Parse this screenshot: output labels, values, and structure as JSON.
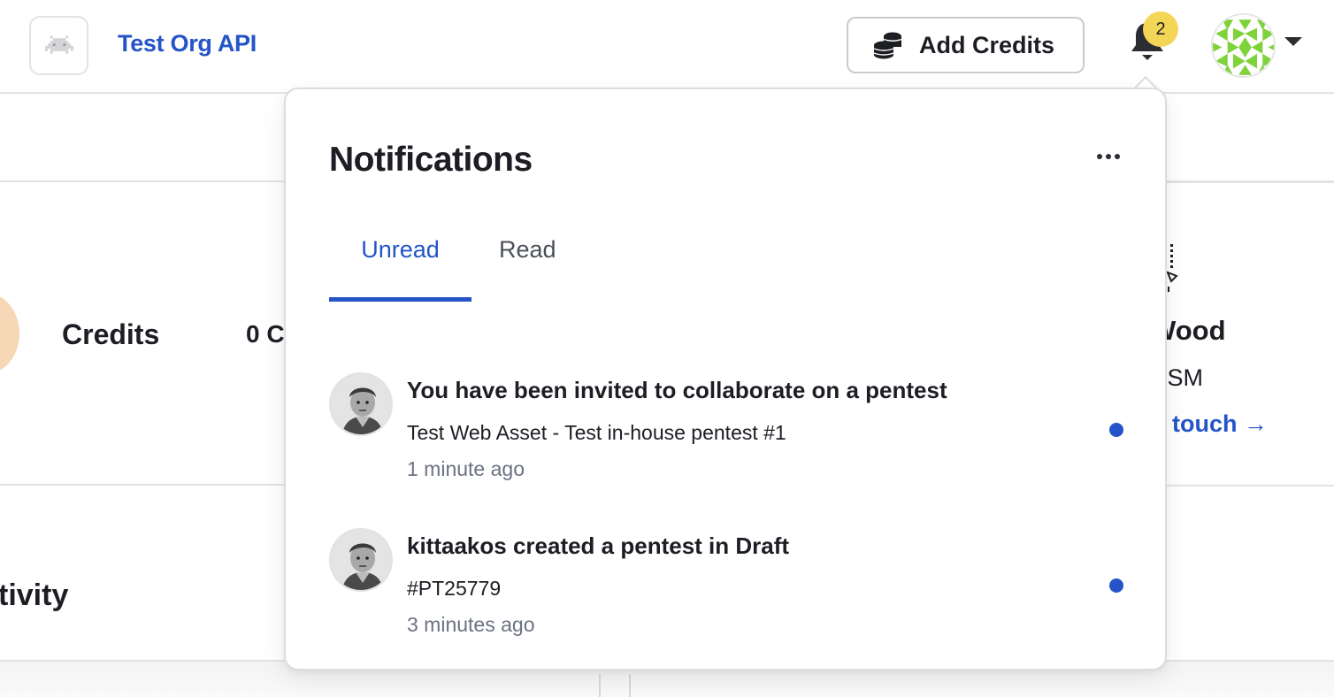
{
  "header": {
    "org_name": "Test Org API",
    "org_logo_icon": "space-invader-icon",
    "add_credits_label": "Add Credits",
    "add_credits_icon": "coins-stack-icon",
    "notification_count": "2",
    "bell_icon": "bell-icon",
    "user_avatar_icon": "green-pattern-avatar",
    "caret_icon": "caret-down-icon"
  },
  "background": {
    "credits_title": "Credits",
    "credits_value": "0 C",
    "activity_title": "tivity",
    "csm_name": "Wood",
    "csm_role": "CSM",
    "csm_link": "touch →"
  },
  "notifications": {
    "title": "Notifications",
    "more_icon": "ellipsis-icon",
    "tabs": [
      {
        "label": "Unread",
        "active": true
      },
      {
        "label": "Read",
        "active": false
      }
    ],
    "items": [
      {
        "title": "You have been invited to collaborate on a pentest",
        "subtitle": "Test Web Asset - Test in-house pentest #1",
        "time": "1 minute ago",
        "unread": true
      },
      {
        "title": "kittaakos created a pentest in Draft",
        "subtitle": "#PT25779",
        "time": "3 minutes ago",
        "unread": true
      }
    ]
  },
  "colors": {
    "brand_blue": "#2454c8",
    "badge_yellow": "#f4d657",
    "text_dark": "#1c1e24",
    "text_muted": "#6b7280",
    "unread_dot": "#2454c8",
    "avatar_green": "#7ed23a",
    "credits_circle": "#f6d7b5"
  }
}
